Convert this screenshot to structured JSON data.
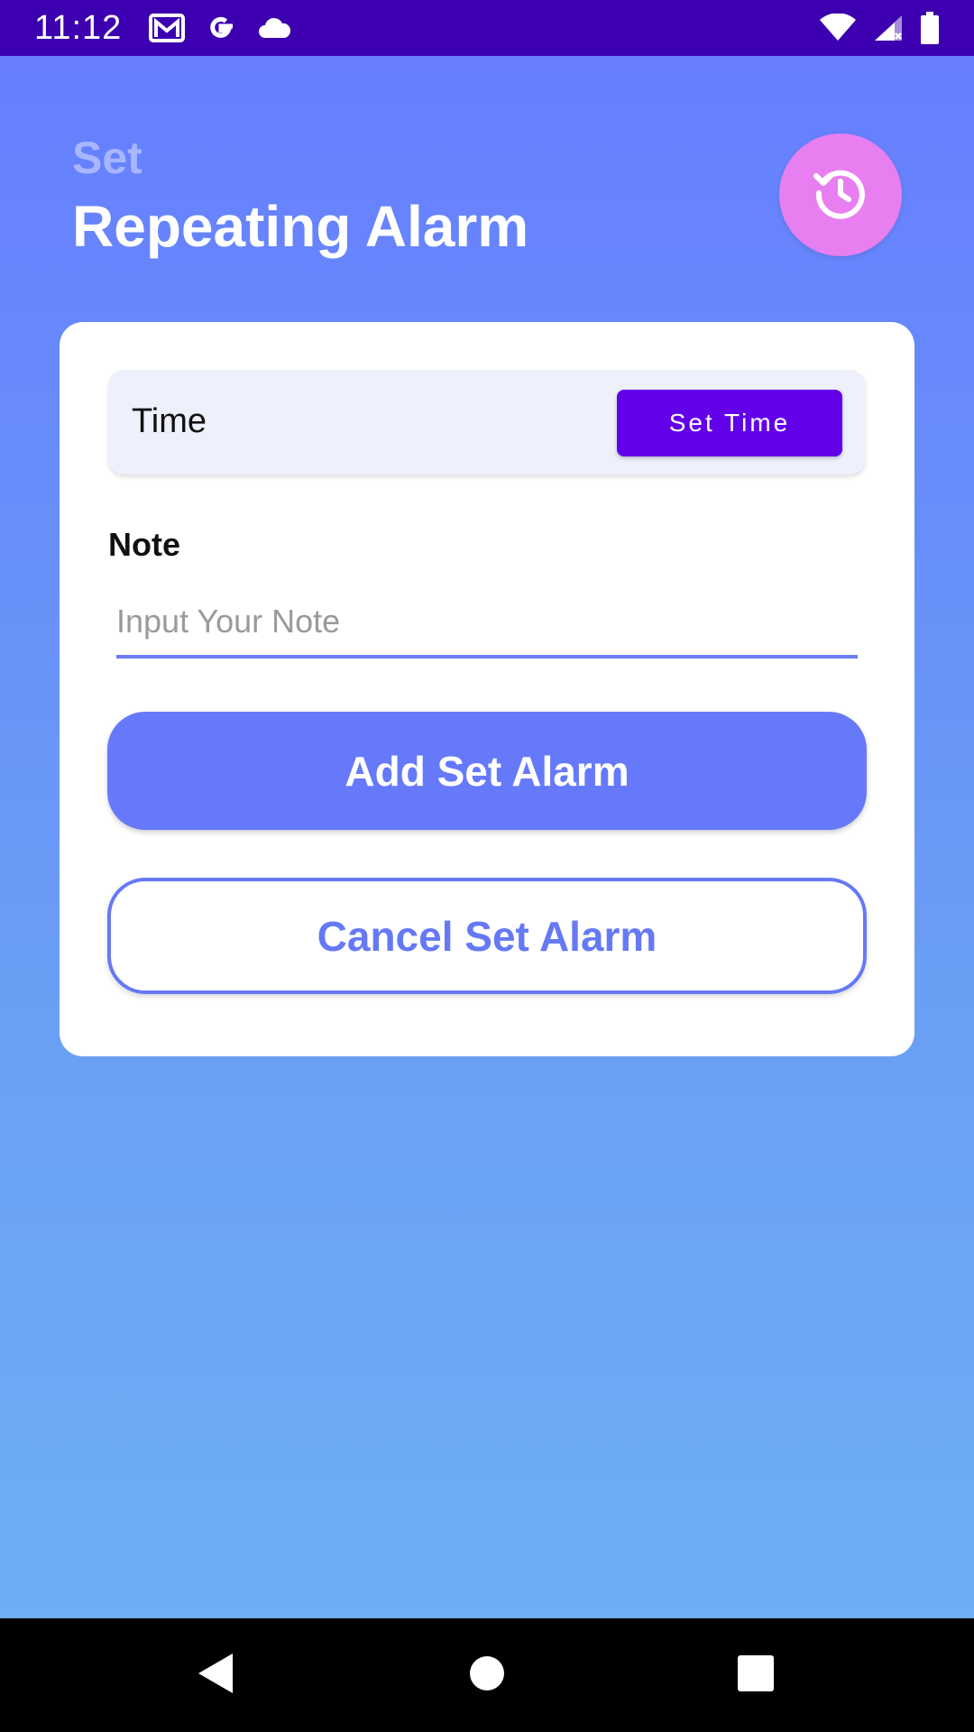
{
  "status_bar": {
    "time": "11:12",
    "left_icons": [
      "gmail-icon",
      "google-icon",
      "cloud-icon"
    ],
    "right_icons": [
      "wifi-icon",
      "cell-signal-icon",
      "battery-icon"
    ]
  },
  "header": {
    "subtitle": "Set",
    "title": "Repeating Alarm",
    "history_icon": "history-icon"
  },
  "card": {
    "time_label": "Time",
    "set_time_label": "Set Time",
    "note_label": "Note",
    "note_placeholder": "Input Your Note",
    "note_value": "",
    "add_label": "Add Set Alarm",
    "cancel_label": "Cancel Set Alarm"
  },
  "nav_bar": {
    "buttons": [
      "back-icon",
      "home-icon",
      "recents-icon"
    ]
  },
  "colors": {
    "status_bar": "#3d00b0",
    "background_top": "#667cff",
    "background_bottom": "#6db2f5",
    "accent_purple": "#6200ea",
    "history_button": "#e77ff0",
    "primary_button": "#6679fa"
  }
}
